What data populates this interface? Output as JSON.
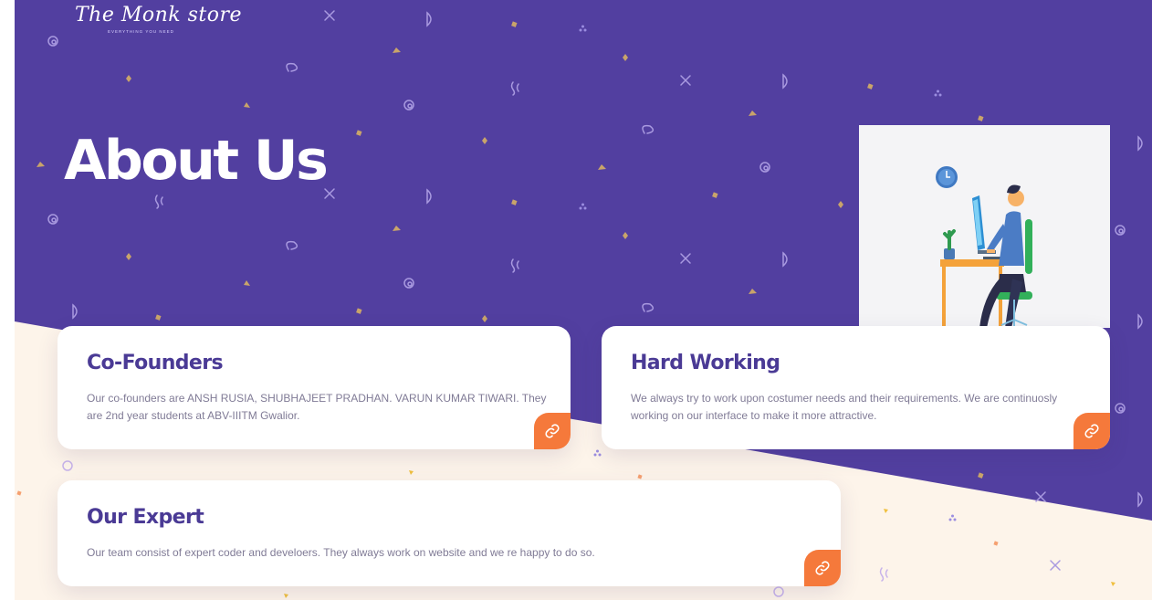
{
  "brand": {
    "logo_text": "The Monk store",
    "tagline": "EVERYTHING YOU NEED"
  },
  "hero": {
    "title": "About Us",
    "illustration_icon": "person-at-desk-illustration"
  },
  "cards": [
    {
      "title": "Co-Founders",
      "text": "Our co-founders are ANSH RUSIA, SHUBHAJEET PRADHAN. VARUN KUMAR TIWARI. They are 2nd year students at ABV-IIITM Gwalior.",
      "icon": "link-icon"
    },
    {
      "title": "Hard Working",
      "text": "We always try to work upon costumer needs and their requirements. We are continuosly working on our interface to make it more attractive.",
      "icon": "link-icon"
    },
    {
      "title": "Our Expert",
      "text": "Our team consist of expert coder and develoers. They always work on website and we re happy to do so.",
      "icon": "link-icon"
    }
  ],
  "colors": {
    "hero_background": "#523fa0",
    "lower_background": "#fdf4ea",
    "card_title": "#4a3a95",
    "accent_button": "#f5793b"
  }
}
